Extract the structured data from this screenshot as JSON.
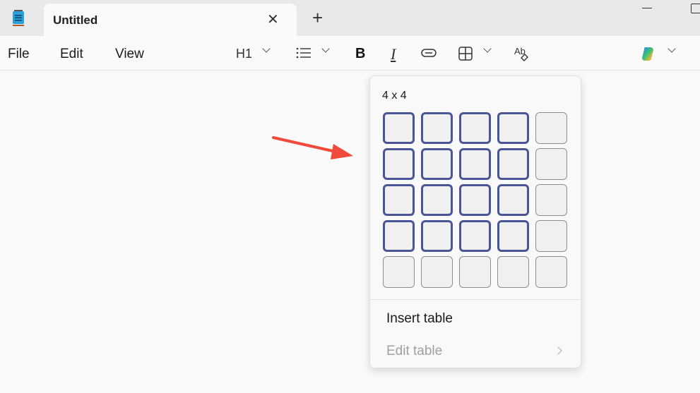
{
  "tab": {
    "title": "Untitled",
    "close": "✕",
    "new": "+"
  },
  "menu": {
    "file": "File",
    "edit": "Edit",
    "view": "View"
  },
  "toolbar": {
    "heading": "H1",
    "bold": "B",
    "italic": "I"
  },
  "table_picker": {
    "size_label": "4 x 4",
    "rows": 5,
    "cols": 5,
    "selected_rows": 4,
    "selected_cols": 4,
    "insert_table": "Insert table",
    "edit_table": "Edit table"
  },
  "colors": {
    "selected_border": "#4a5596",
    "annotation_arrow": "#f04a3a"
  }
}
